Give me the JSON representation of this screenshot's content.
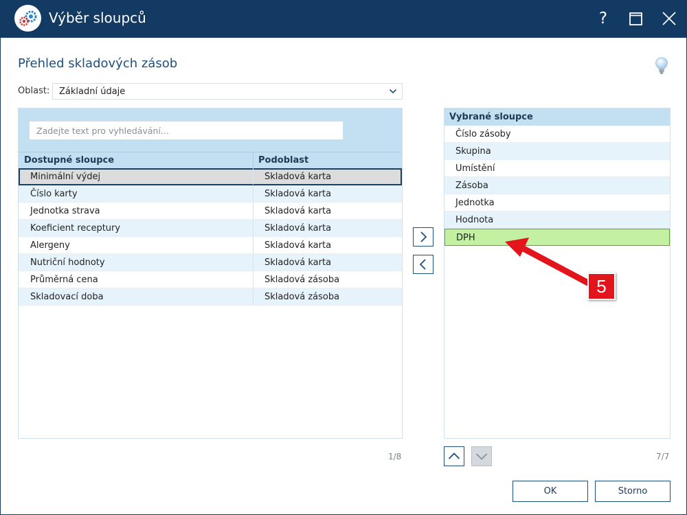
{
  "window": {
    "title": "Výběr sloupců",
    "help_label": "?"
  },
  "page": {
    "title": "Přehled skladových zásob"
  },
  "oblast": {
    "label": "Oblast:",
    "value": "Základní údaje"
  },
  "available": {
    "search_placeholder": "Zadejte text pro vyhledávání...",
    "columns": [
      "Dostupné sloupce",
      "Podoblast"
    ],
    "rows": [
      [
        "Minimální výdej",
        "Skladová karta"
      ],
      [
        "Číslo karty",
        "Skladová karta"
      ],
      [
        "Jednotka strava",
        "Skladová karta"
      ],
      [
        "Koeficient receptury",
        "Skladová karta"
      ],
      [
        "Alergeny",
        "Skladová karta"
      ],
      [
        "Nutriční hodnoty",
        "Skladová karta"
      ],
      [
        "Průměrná cena",
        "Skladová zásoba"
      ],
      [
        "Skladovací doba",
        "Skladová zásoba"
      ]
    ],
    "selected_index": 0,
    "counter": "1/8"
  },
  "selected": {
    "header": "Vybrané sloupce",
    "rows": [
      "Číslo zásoby",
      "Skupina",
      "Umístění",
      "Zásoba",
      "Jednotka",
      "Hodnota",
      "DPH"
    ],
    "highlight_index": 6,
    "counter": "7/7"
  },
  "buttons": {
    "ok": "OK",
    "storno": "Storno"
  },
  "annotation": {
    "number": "5",
    "color": "#e2141c"
  },
  "colors": {
    "titlebar": "#123a63",
    "accent": "#1c4f80",
    "grid_header": "#c3e0f2",
    "highlight": "#c4f0a2"
  },
  "icons": {
    "app": "app-logo",
    "help": "help-icon",
    "maximize": "maximize-icon",
    "close": "close-icon",
    "bulb": "lightbulb-icon",
    "dropdown": "chevron-down-icon",
    "move_right": "chevron-right-icon",
    "move_left": "chevron-left-icon",
    "move_up": "chevron-up-icon",
    "move_down": "chevron-down-icon"
  }
}
